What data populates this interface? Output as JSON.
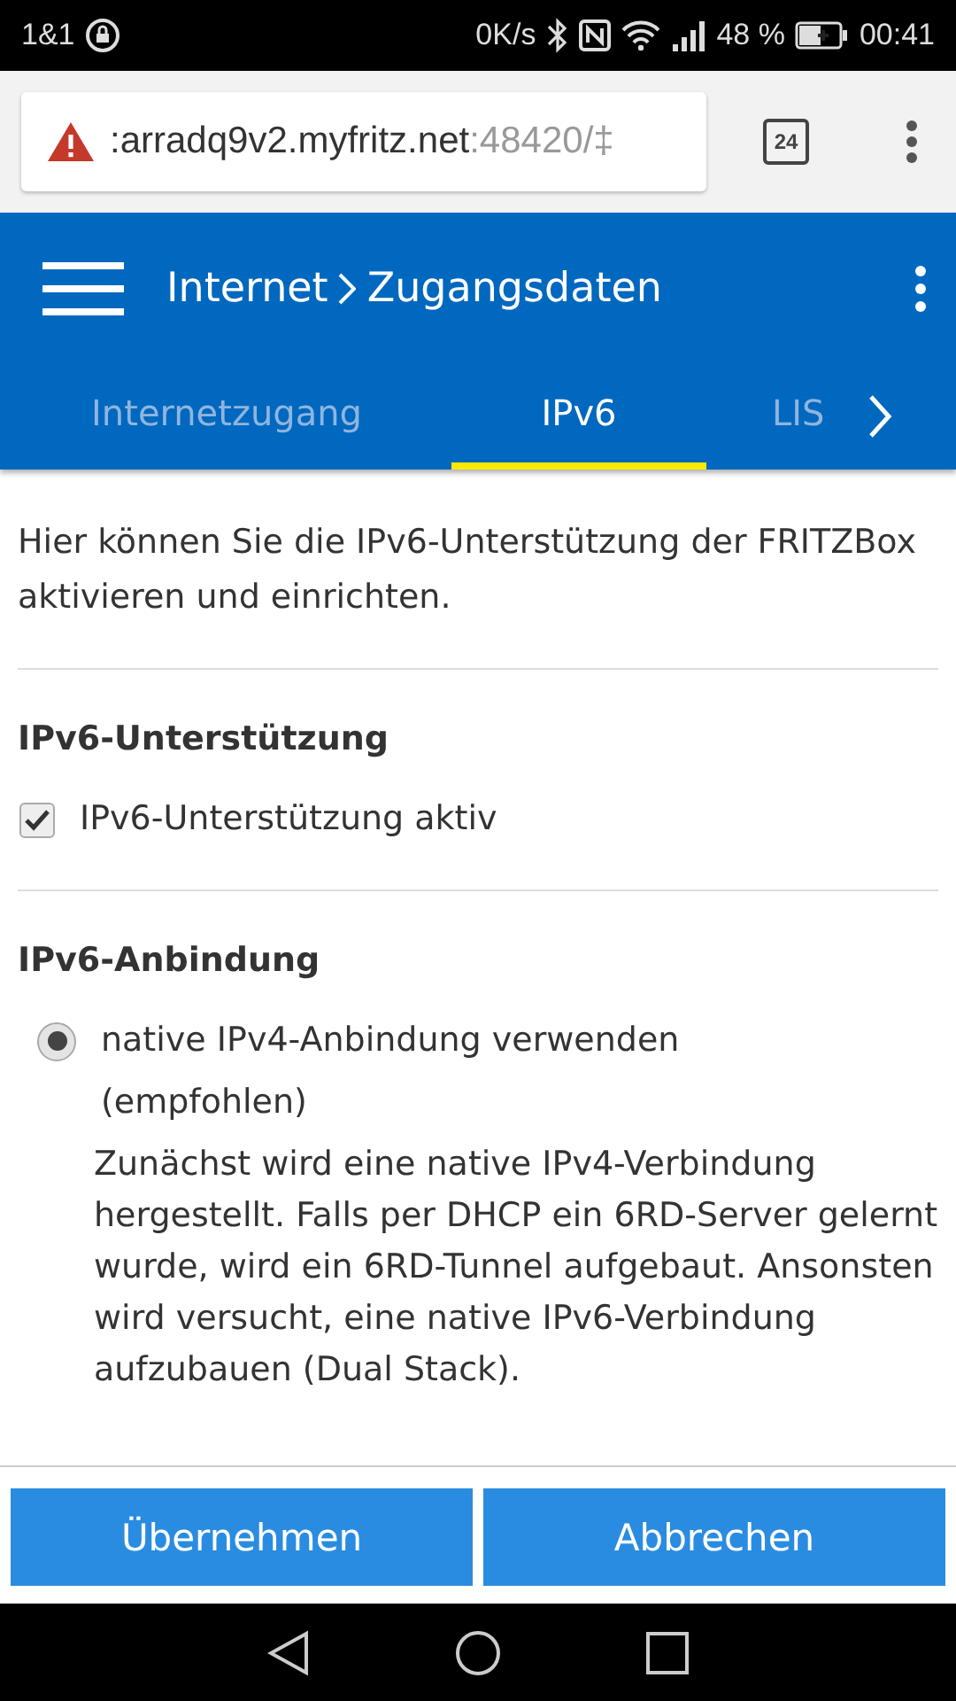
{
  "status_bar": {
    "carrier": "1&1",
    "speed": "0K/s",
    "battery": "48 %",
    "time": "00:41"
  },
  "browser": {
    "url_host": ":arradq9v2.myfritz.net",
    "url_rest": ":48420/‡",
    "tab_count": "24"
  },
  "header": {
    "title": "Internet",
    "subtitle": "Zugangsdaten"
  },
  "tabs": [
    {
      "label": "Internetzugang",
      "selected": false
    },
    {
      "label": "IPv6",
      "selected": true
    },
    {
      "label": "LIS",
      "selected": false
    }
  ],
  "intro": "Hier können Sie die IPv6-Unterstützung der FRITZBox aktivieren und einrichten.",
  "sections": [
    {
      "title": "IPv6-Unterstützung",
      "kind": "checkbox",
      "label": "IPv6-Unterstützung aktiv",
      "checked": true
    },
    {
      "title": "IPv6-Anbindung",
      "kind": "radio",
      "label": "native IPv4-Anbindung verwenden",
      "note": "(empfohlen)",
      "selected": true,
      "description": "Zunächst wird eine native IPv4-Verbindung hergestellt. Falls per DHCP ein 6RD-Server gelernt wurde, wird ein 6RD-Tunnel aufgebaut. Ansonsten wird versucht, eine native IPv6-Verbindung aufzubauen (Dual Stack)."
    }
  ],
  "buttons": [
    "Übernehmen",
    "Abbrechen"
  ]
}
